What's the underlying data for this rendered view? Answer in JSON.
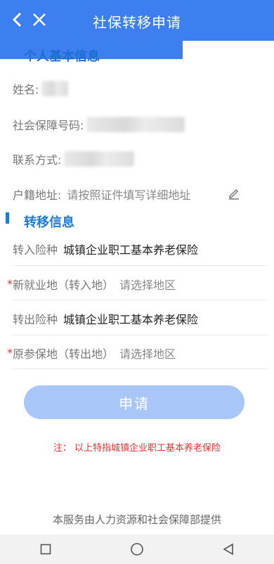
{
  "header": {
    "title": "社保转移申请"
  },
  "personal": {
    "section_title": "个人基本信息",
    "name_label": "姓名:",
    "ssn_label": "社会保障号码:",
    "contact_label": "联系方式:",
    "household_label": "户籍地址:",
    "household_placeholder": "请按照证件填写详细地址"
  },
  "transfer": {
    "section_title": "转移信息",
    "in_type_label": "转入险种",
    "in_type_value": "城镇企业职工基本养老保险",
    "new_location_label": "新就业地（转入地）",
    "new_location_placeholder": "请选择地区",
    "out_type_label": "转出险种",
    "out_type_value": "城镇企业职工基本养老保险",
    "original_location_label": "原参保地（转出地）",
    "original_location_placeholder": "请选择地区",
    "required_mark": "*"
  },
  "actions": {
    "apply_label": "申请"
  },
  "note": "注：  以上特指城镇企业职工基本养老保险",
  "footer": "本服务由人力资源和社会保障部提供",
  "icons": [
    "back-icon",
    "close-icon",
    "edit-icon",
    "nav-square-icon",
    "nav-circle-icon",
    "nav-back-icon"
  ],
  "colors": {
    "header": "#3d7ff0",
    "section": "#1e7bd6",
    "button": "#a8c6f7",
    "note": "#e03131"
  }
}
